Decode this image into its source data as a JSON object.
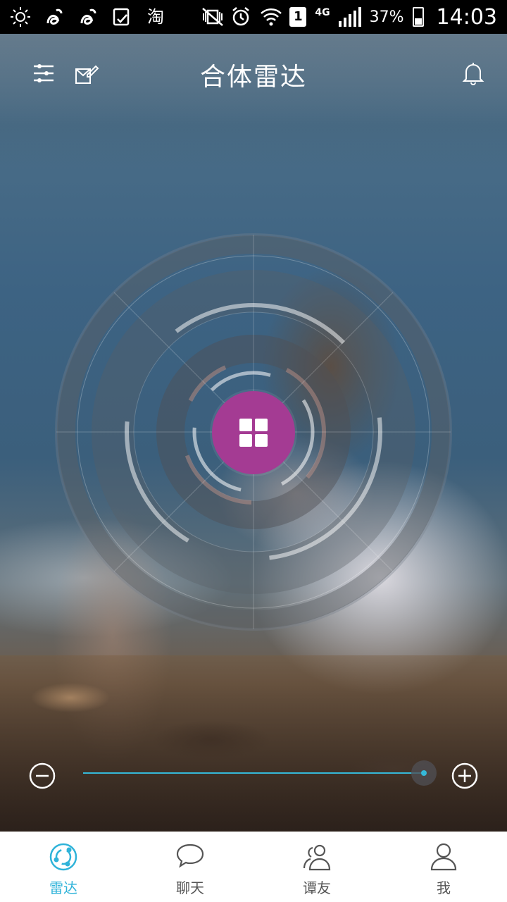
{
  "status_bar": {
    "left_icons": [
      "sun-icon",
      "squirrel-icon",
      "squirrel-icon",
      "check-square-icon",
      "taobao-icon"
    ],
    "taobao_text": "淘",
    "right_icons": [
      "vibrate-mute-icon",
      "alarm-icon",
      "wifi-icon",
      "sim-icon",
      "signal-icon",
      "battery-icon"
    ],
    "sim_slot": "1",
    "network": "4G",
    "battery_percent": "37%",
    "battery_level": 0.37,
    "time": "14:03"
  },
  "header": {
    "title": "合体雷达",
    "left_icons": [
      "filter-sliders-icon",
      "edit-envelope-icon"
    ],
    "right_icon": "bell-icon"
  },
  "radar": {
    "center_icon": "grid-icon",
    "center_color": "#a43b93"
  },
  "zoom": {
    "out_icon": "minus-circle-icon",
    "in_icon": "plus-circle-icon",
    "level": 1.0,
    "accent_color": "#35b8d8"
  },
  "tabs": [
    {
      "label": "雷达",
      "icon": "radar-icon",
      "active": true
    },
    {
      "label": "聊天",
      "icon": "chat-bubble-icon",
      "active": false
    },
    {
      "label": "谭友",
      "icon": "friends-icon",
      "active": false
    },
    {
      "label": "我",
      "icon": "user-icon",
      "active": false
    }
  ],
  "colors": {
    "active_tab": "#2fb3d9",
    "inactive_tab": "#555555",
    "accent": "#a43b93"
  }
}
